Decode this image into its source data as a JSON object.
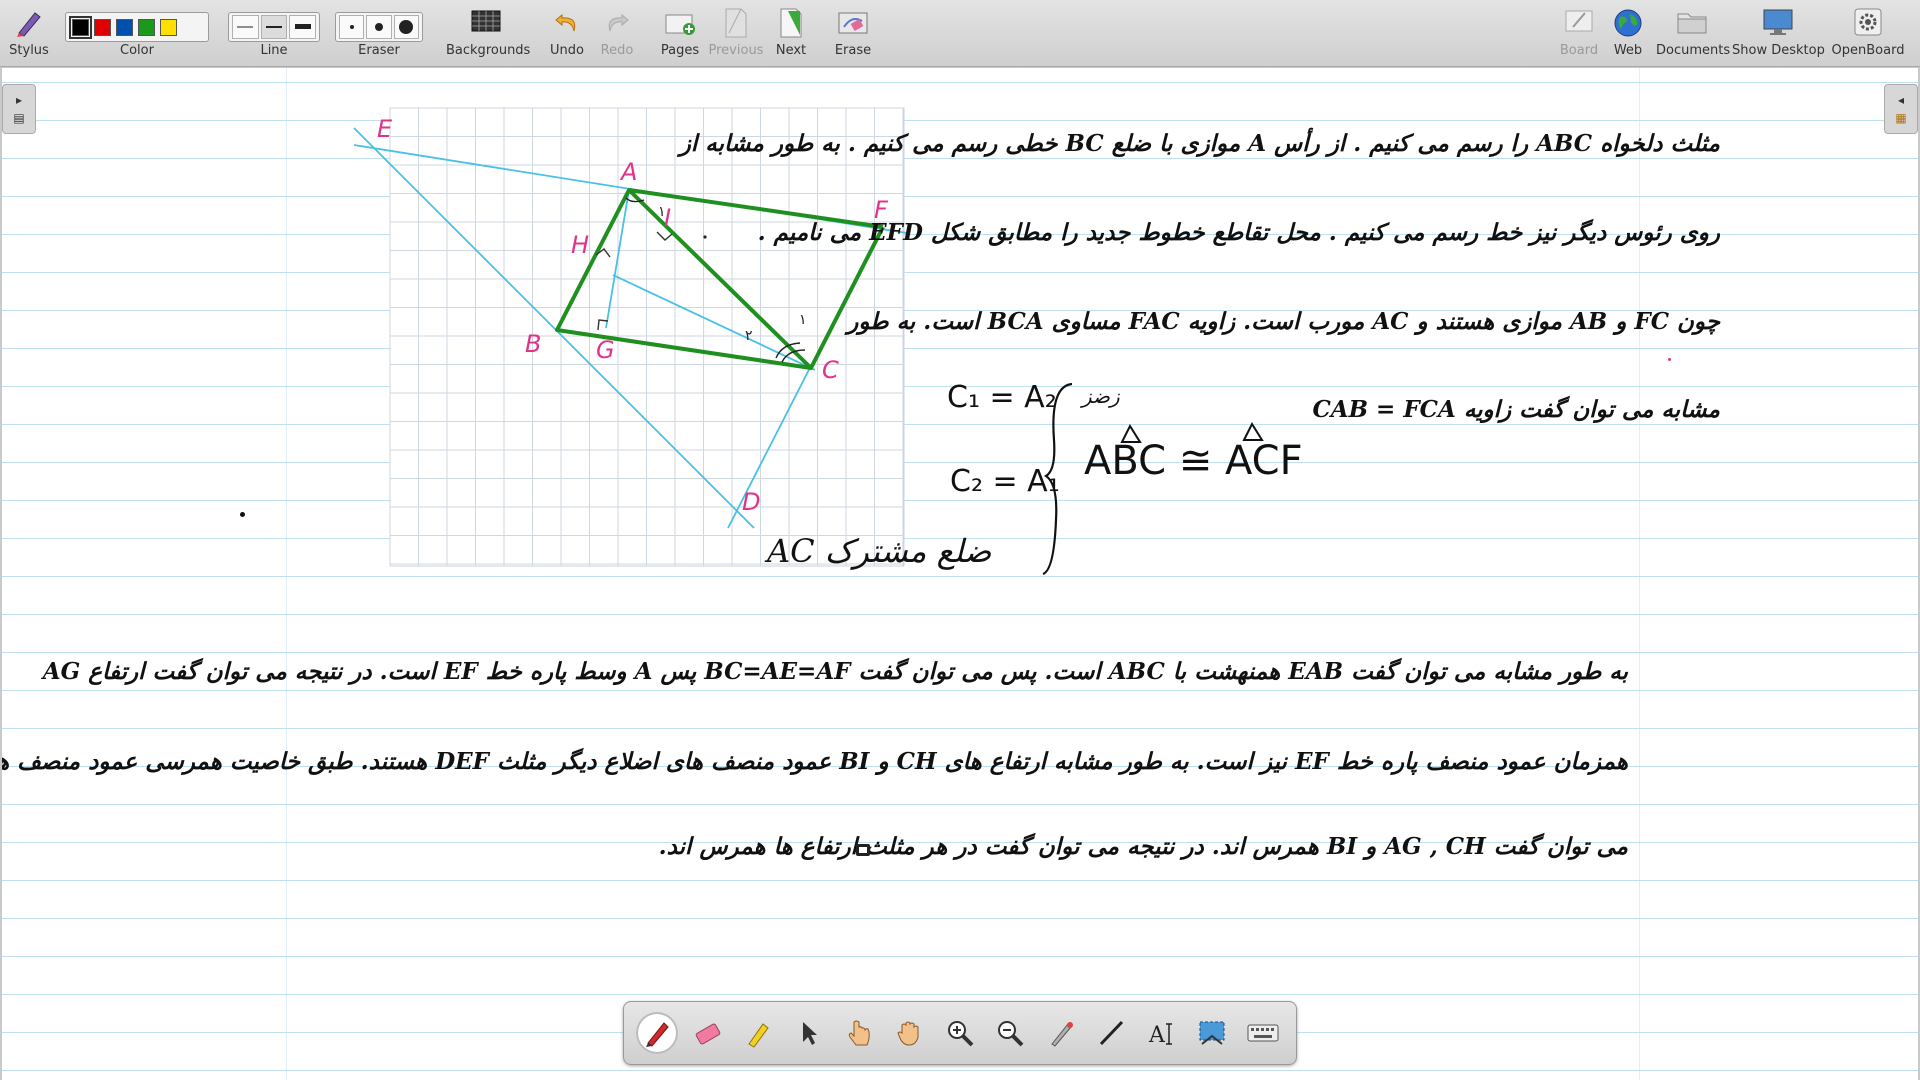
{
  "toolbar": {
    "stylus": "Stylus",
    "color": "Color",
    "line": "Line",
    "eraser": "Eraser",
    "backgrounds": "Backgrounds",
    "undo": "Undo",
    "redo": "Redo",
    "pages": "Pages",
    "previous": "Previous",
    "next": "Next",
    "erase": "Erase",
    "board": "Board",
    "web": "Web",
    "documents": "Documents",
    "show_desktop": "Show Desktop",
    "openboard": "OpenBoard",
    "colors": [
      "#000000",
      "#e00000",
      "#0050b0",
      "#1a9a1a",
      "#ffe000"
    ]
  },
  "figure": {
    "labels": {
      "E": "E",
      "A": "A",
      "F": "F",
      "H": "H",
      "I": "I",
      "B": "B",
      "G": "G",
      "C": "C",
      "D": "D"
    },
    "angle_1_top": "۱",
    "angle_1_right": "۱",
    "angle_2": "۲",
    "triangle_color": "#1f8f1f",
    "lines_color": "#49c0e6",
    "label_color": "#e0338a"
  },
  "text": {
    "p1_l1": "مثلث دلخواه ABC را رسم می کنیم . از رأس A موازی با ضلع BC خطی رسم می کنیم . به طور مشابه از",
    "p1_l2": "روی رئوس دیگر نیز خط رسم می کنیم . محل تقاطع خطوط جدید را مطابق شکل EFD می نامیم .",
    "p2_l1": "چون FC و AB موازی هستند و AC مورب است. زاویه FAC مساوی BCA است. به طور",
    "p2_l2": "مشابه می توان گفت زاویه CAB = FCA",
    "p3_l1": "به طور مشابه می توان گفت EAB همنهشت با ABC است. پس می توان گفت BC=AE=AF پس A وسط پاره خط EF است. در نتیجه می توان گفت ارتفاع AG",
    "p3_l2": "همزمان عمود منصف پاره خط EF نیز است. به طور مشابه ارتفاع های CH و BI عمود منصف های اضلاع دیگر مثلث DEF هستند. طبق خاصیت همرسی عمود منصف های مثلث ها",
    "p3_l3": "می توان گفت AG , CH و BI همرس اند. در نتیجه می توان گفت در هر مثلث ارتفاع ها همرس اند."
  },
  "handwriting": {
    "eq1": "C₁ = A₂",
    "eq2": "C₂ = A₁",
    "eq3": "ضلع مشترک AC",
    "note": "زضز",
    "congruence": "ABC ≅ ACF"
  }
}
